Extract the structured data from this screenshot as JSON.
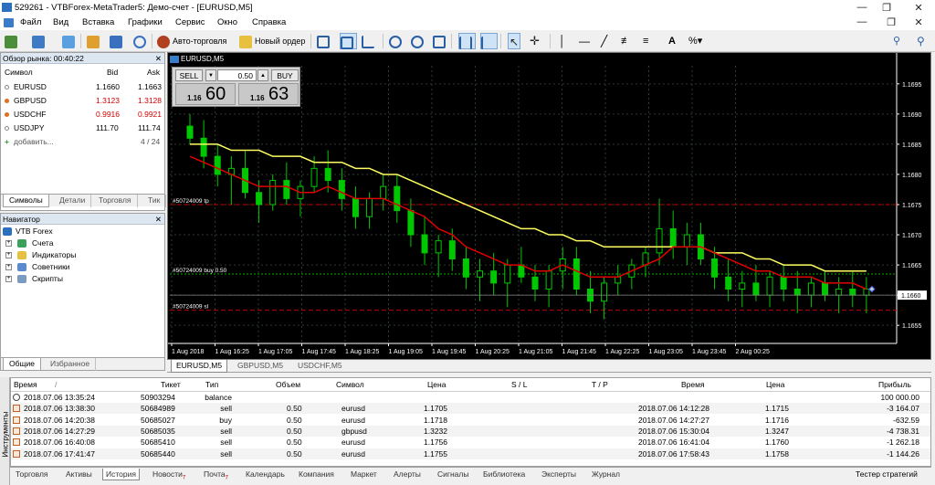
{
  "window": {
    "title": "529261 - VTBForex-MetaTrader5: Демо-счет - [EURUSD,M5]"
  },
  "menu": [
    "Файл",
    "Вид",
    "Вставка",
    "Графики",
    "Сервис",
    "Окно",
    "Справка"
  ],
  "toolbar": {
    "autotrading_label": "Авто-торговля",
    "neworder_label": "Новый ордер"
  },
  "market_watch": {
    "title": "Обзор рынка: 00:40:22",
    "col_symbol": "Символ",
    "col_bid": "Bid",
    "col_ask": "Ask",
    "rows": [
      {
        "symbol": "EURUSD",
        "bid": "1.1660",
        "ask": "1.1663"
      },
      {
        "symbol": "GBPUSD",
        "bid": "1.3123",
        "ask": "1.3128"
      },
      {
        "symbol": "USDCHF",
        "bid": "0.9916",
        "ask": "0.9921"
      },
      {
        "symbol": "USDJPY",
        "bid": "111.70",
        "ask": "111.74"
      }
    ],
    "add_label": "добавить...",
    "count": "4 / 24",
    "tabs": [
      "Символы",
      "Детали",
      "Торговля",
      "Тик"
    ]
  },
  "navigator": {
    "title": "Навигатор",
    "root": "VTB Forex",
    "items": [
      "Счета",
      "Индикаторы",
      "Советники",
      "Скрипты"
    ],
    "tabs": [
      "Общие",
      "Избранное"
    ]
  },
  "chart": {
    "label": "EURUSD,M5",
    "one_click": {
      "sell": "SELL",
      "buy": "BUY",
      "volume": "0.50",
      "sell_big": "60",
      "sell_small": "1.16",
      "buy_big": "63",
      "buy_small": "1.16"
    },
    "lines": {
      "tp": "#50724009 tp",
      "buy": "#50724009 buy 0.50",
      "sl": "#50724009 sl"
    },
    "current_price": "1.1660",
    "colors": {
      "bg": "#000000",
      "bull": "#00c800",
      "bear": "#00c800",
      "ma_fast": "#e00000",
      "ma_slow": "#ffff60",
      "grid": "#2e3a2e",
      "tp_line": "#c00000",
      "sl_line": "#c00000",
      "buy_line": "#00b000"
    },
    "tabs": [
      "EURUSD,M5",
      "GBPUSD,M5",
      "USDCHF,M5"
    ]
  },
  "chart_data": {
    "type": "candlestick",
    "ylim": [
      1.1652,
      1.1698
    ],
    "y_ticks": [
      "1.1695",
      "1.1690",
      "1.1685",
      "1.1680",
      "1.1675",
      "1.1670",
      "1.1665",
      "1.1660",
      "1.1655"
    ],
    "x_ticks": [
      "1 Aug 2018",
      "1 Aug 16:25",
      "1 Aug 17:05",
      "1 Aug 17:45",
      "1 Aug 18:25",
      "1 Aug 19:05",
      "1 Aug 19:45",
      "1 Aug 20:25",
      "1 Aug 21:05",
      "1 Aug 21:45",
      "1 Aug 22:25",
      "1 Aug 23:05",
      "1 Aug 23:45",
      "2 Aug 00:25"
    ],
    "tp_level": 1.1675,
    "buy_level": 1.16635,
    "sl_level": 1.16575,
    "candles": [
      [
        1.1688,
        1.169,
        1.1685,
        1.1686
      ],
      [
        1.1686,
        1.1689,
        1.1681,
        1.1683
      ],
      [
        1.1683,
        1.1685,
        1.1678,
        1.168
      ],
      [
        1.168,
        1.1683,
        1.1675,
        1.1681
      ],
      [
        1.1681,
        1.1684,
        1.1676,
        1.1677
      ],
      [
        1.1677,
        1.1679,
        1.1672,
        1.1675
      ],
      [
        1.1675,
        1.168,
        1.1674,
        1.1679
      ],
      [
        1.1679,
        1.1682,
        1.1675,
        1.1676
      ],
      [
        1.1676,
        1.1679,
        1.1673,
        1.1678
      ],
      [
        1.1678,
        1.1683,
        1.1677,
        1.1681
      ],
      [
        1.1681,
        1.1684,
        1.1677,
        1.1679
      ],
      [
        1.1679,
        1.1681,
        1.1674,
        1.1676
      ],
      [
        1.1676,
        1.1678,
        1.1671,
        1.1673
      ],
      [
        1.1673,
        1.1677,
        1.1671,
        1.1676
      ],
      [
        1.1676,
        1.168,
        1.1674,
        1.1678
      ],
      [
        1.1678,
        1.168,
        1.1672,
        1.1674
      ],
      [
        1.1674,
        1.1676,
        1.1668,
        1.167
      ],
      [
        1.167,
        1.1673,
        1.1665,
        1.1667
      ],
      [
        1.1667,
        1.167,
        1.1663,
        1.1669
      ],
      [
        1.1669,
        1.1671,
        1.1664,
        1.1666
      ],
      [
        1.1666,
        1.1668,
        1.1661,
        1.1663
      ],
      [
        1.1663,
        1.1666,
        1.1659,
        1.1664
      ],
      [
        1.1664,
        1.1667,
        1.166,
        1.1662
      ],
      [
        1.1662,
        1.1666,
        1.1658,
        1.1665
      ],
      [
        1.1665,
        1.1668,
        1.1662,
        1.1663
      ],
      [
        1.1663,
        1.1665,
        1.1659,
        1.1661
      ],
      [
        1.1661,
        1.1665,
        1.1658,
        1.1664
      ],
      [
        1.1664,
        1.1668,
        1.1661,
        1.1666
      ],
      [
        1.1666,
        1.1668,
        1.166,
        1.1661
      ],
      [
        1.1661,
        1.1664,
        1.1657,
        1.1659
      ],
      [
        1.1659,
        1.1663,
        1.1656,
        1.1662
      ],
      [
        1.1662,
        1.1665,
        1.166,
        1.1663
      ],
      [
        1.1663,
        1.1666,
        1.1661,
        1.1665
      ],
      [
        1.1665,
        1.1668,
        1.1663,
        1.1667
      ],
      [
        1.1667,
        1.1676,
        1.1665,
        1.1671
      ],
      [
        1.1671,
        1.1674,
        1.1666,
        1.1668
      ],
      [
        1.1668,
        1.1672,
        1.1665,
        1.167
      ],
      [
        1.167,
        1.1672,
        1.1665,
        1.1666
      ],
      [
        1.1666,
        1.1668,
        1.1661,
        1.1663
      ],
      [
        1.1663,
        1.1666,
        1.1659,
        1.1661
      ],
      [
        1.1661,
        1.1664,
        1.1658,
        1.1662
      ],
      [
        1.1662,
        1.1665,
        1.1659,
        1.166
      ],
      [
        1.166,
        1.1664,
        1.1658,
        1.1663
      ],
      [
        1.1663,
        1.1665,
        1.1659,
        1.1661
      ],
      [
        1.1661,
        1.1664,
        1.1657,
        1.166
      ],
      [
        1.166,
        1.1663,
        1.1658,
        1.1662
      ],
      [
        1.1662,
        1.1664,
        1.1659,
        1.166
      ],
      [
        1.166,
        1.1663,
        1.1657,
        1.1661
      ],
      [
        1.1661,
        1.1664,
        1.1658,
        1.166
      ],
      [
        1.166,
        1.1663,
        1.1657,
        1.1661
      ]
    ],
    "ma_fast": [
      1.1683,
      1.1682,
      1.1681,
      1.168,
      1.1679,
      1.1678,
      1.1678,
      1.1678,
      1.1677,
      1.1677,
      1.1678,
      1.1677,
      1.1676,
      1.1676,
      1.1676,
      1.1675,
      1.1674,
      1.1673,
      1.1671,
      1.167,
      1.1668,
      1.1667,
      1.1666,
      1.1665,
      1.1665,
      1.1664,
      1.1664,
      1.1665,
      1.1664,
      1.1663,
      1.1663,
      1.1663,
      1.1664,
      1.1665,
      1.1666,
      1.1668,
      1.1668,
      1.1668,
      1.1667,
      1.1666,
      1.1665,
      1.1664,
      1.1664,
      1.1663,
      1.1663,
      1.1663,
      1.1662,
      1.1662,
      1.1662,
      1.1661
    ],
    "ma_slow": [
      1.1685,
      1.1685,
      1.1685,
      1.1684,
      1.1684,
      1.1684,
      1.1683,
      1.1683,
      1.1683,
      1.1682,
      1.1682,
      1.1682,
      1.1681,
      1.1681,
      1.168,
      1.168,
      1.1679,
      1.1678,
      1.1677,
      1.1676,
      1.1675,
      1.1674,
      1.1673,
      1.1672,
      1.1671,
      1.1671,
      1.167,
      1.167,
      1.1669,
      1.1669,
      1.1668,
      1.1668,
      1.1668,
      1.1668,
      1.1668,
      1.1668,
      1.1668,
      1.1668,
      1.1667,
      1.1667,
      1.1667,
      1.1666,
      1.1666,
      1.1665,
      1.1665,
      1.1665,
      1.1664,
      1.1664,
      1.1664,
      1.1664
    ]
  },
  "terminal": {
    "side_label": "Инструменты",
    "columns": [
      "Время",
      "Тикет",
      "Тип",
      "Объем",
      "Символ",
      "Цена",
      "S / L",
      "T / P",
      "Время",
      "Цена",
      "Прибыль"
    ],
    "rows": [
      {
        "time": "2018.07.06 13:35:24",
        "ticket": "50903294",
        "type": "balance",
        "volume": "",
        "symbol": "",
        "price": "",
        "sl": "",
        "tp": "",
        "time2": "",
        "price2": "",
        "profit": "100 000.00"
      },
      {
        "time": "2018.07.06 13:38:30",
        "ticket": "50684989",
        "type": "sell",
        "volume": "0.50",
        "symbol": "eurusd",
        "price": "1.1705",
        "sl": "",
        "tp": "",
        "time2": "2018.07.06 14:12:28",
        "price2": "1.1715",
        "profit": "-3 164.07"
      },
      {
        "time": "2018.07.06 14:20:38",
        "ticket": "50685027",
        "type": "buy",
        "volume": "0.50",
        "symbol": "eurusd",
        "price": "1.1718",
        "sl": "",
        "tp": "",
        "time2": "2018.07.06 14:27:27",
        "price2": "1.1716",
        "profit": "-632.59"
      },
      {
        "time": "2018.07.06 14:27:29",
        "ticket": "50685035",
        "type": "sell",
        "volume": "0.50",
        "symbol": "gbpusd",
        "price": "1.3232",
        "sl": "",
        "tp": "",
        "time2": "2018.07.06 15:30:04",
        "price2": "1.3247",
        "profit": "-4 738.31"
      },
      {
        "time": "2018.07.06 16:40:08",
        "ticket": "50685410",
        "type": "sell",
        "volume": "0.50",
        "symbol": "eurusd",
        "price": "1.1756",
        "sl": "",
        "tp": "",
        "time2": "2018.07.06 16:41:04",
        "price2": "1.1760",
        "profit": "-1 262.18"
      },
      {
        "time": "2018.07.06 17:41:47",
        "ticket": "50685440",
        "type": "sell",
        "volume": "0.50",
        "symbol": "eurusd",
        "price": "1.1755",
        "sl": "",
        "tp": "",
        "time2": "2018.07.06 17:58:43",
        "price2": "1.1758",
        "profit": "-1 144.26"
      }
    ],
    "tabs": [
      {
        "label": "Торговля",
        "badge": ""
      },
      {
        "label": "Активы",
        "badge": ""
      },
      {
        "label": "История",
        "badge": ""
      },
      {
        "label": "Новости",
        "badge": "7"
      },
      {
        "label": "Почта",
        "badge": "7"
      },
      {
        "label": "Календарь",
        "badge": ""
      },
      {
        "label": "Компания",
        "badge": ""
      },
      {
        "label": "Маркет",
        "badge": ""
      },
      {
        "label": "Алерты",
        "badge": ""
      },
      {
        "label": "Сигналы",
        "badge": ""
      },
      {
        "label": "Библиотека",
        "badge": ""
      },
      {
        "label": "Эксперты",
        "badge": ""
      },
      {
        "label": "Журнал",
        "badge": ""
      }
    ],
    "strategy_tester": "Тестер стратегий"
  }
}
